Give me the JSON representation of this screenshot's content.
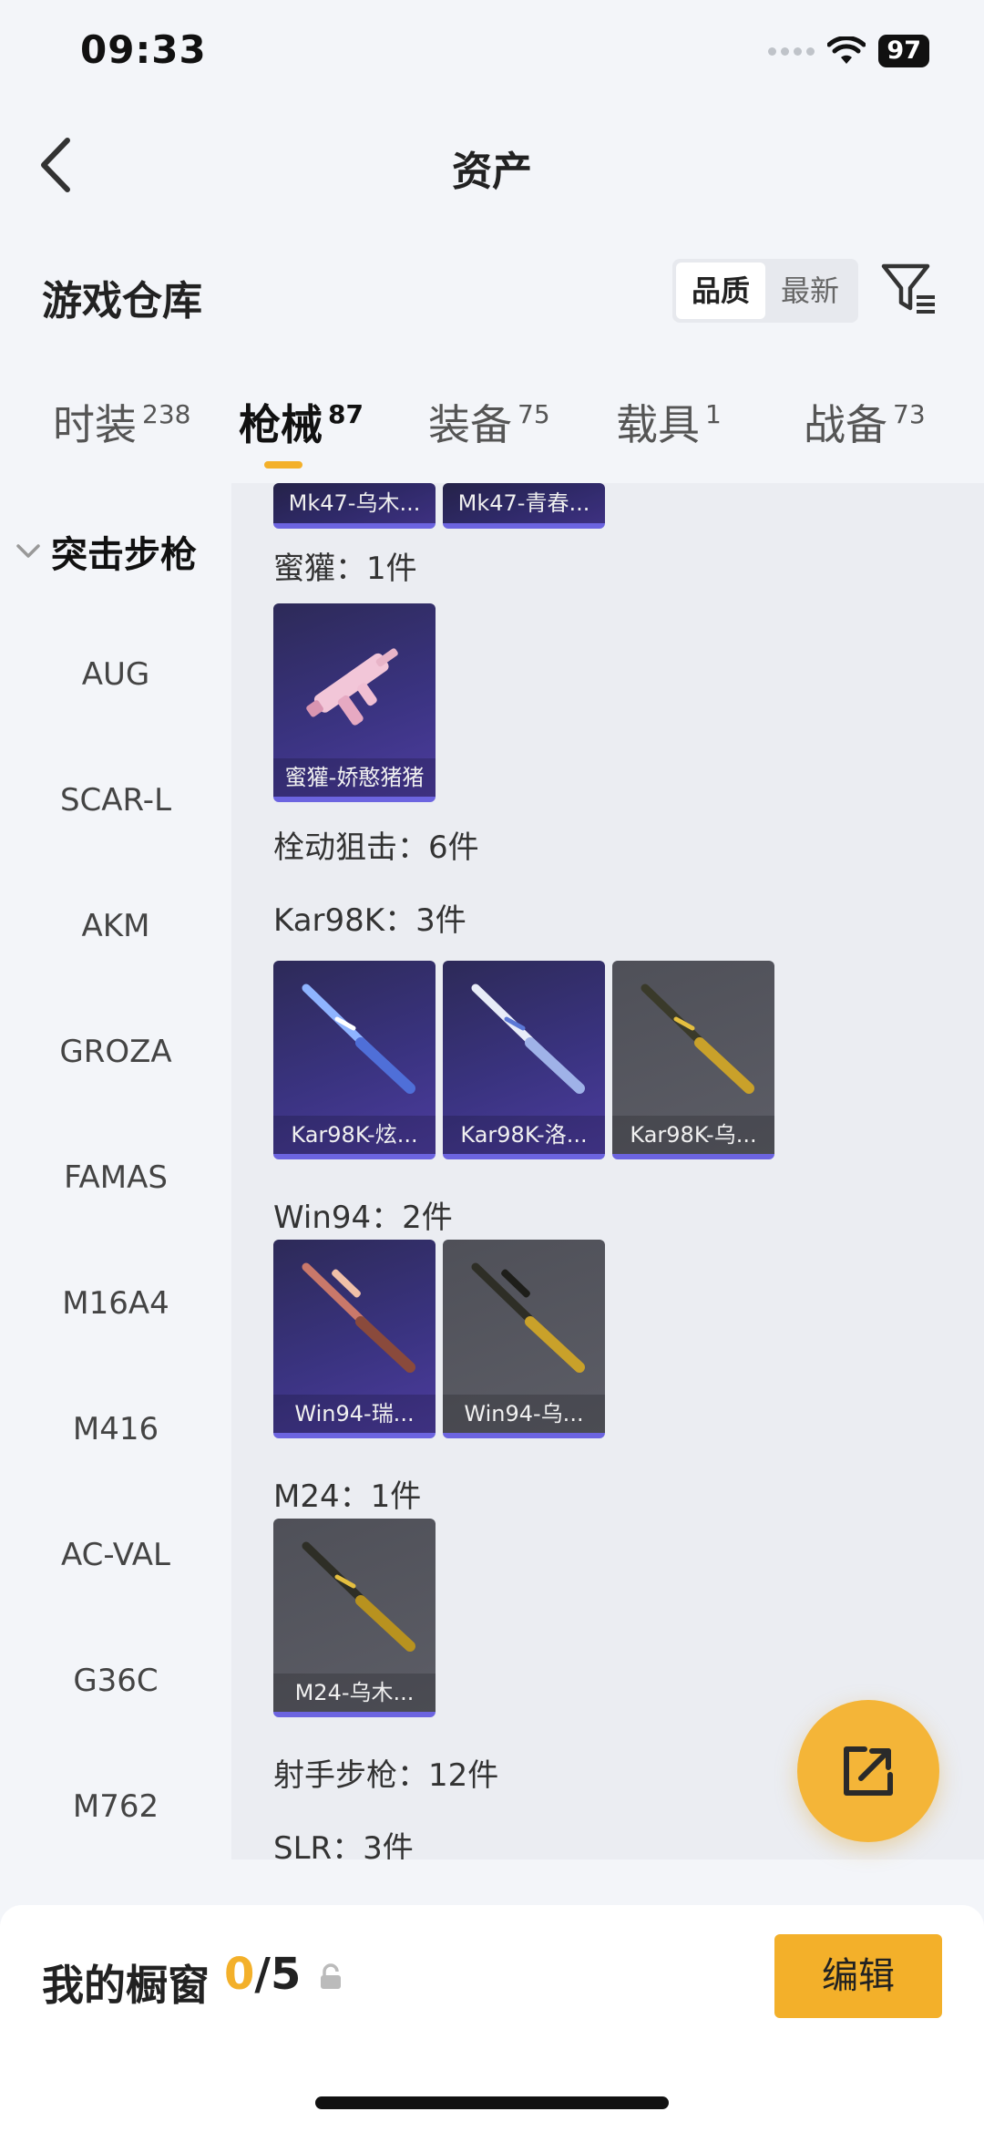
{
  "status_bar": {
    "time": "09:33",
    "battery": "97"
  },
  "nav": {
    "title": "资产"
  },
  "warehouse": {
    "title": "游戏仓库",
    "sort_options": [
      "品质",
      "最新"
    ],
    "active_sort": "品质"
  },
  "tabs": [
    {
      "label": "时装",
      "count": "238"
    },
    {
      "label": "枪械",
      "count": "87"
    },
    {
      "label": "装备",
      "count": "75"
    },
    {
      "label": "载具",
      "count": "1"
    },
    {
      "label": "战备",
      "count": "73"
    }
  ],
  "active_tab": "枪械",
  "sidebar": {
    "group": "突击步枪",
    "items": [
      "AUG",
      "SCAR-L",
      "AKM",
      "GROZA",
      "FAMAS",
      "M16A4",
      "M416",
      "AC-VAL",
      "G36C",
      "M762"
    ]
  },
  "content": {
    "top_cards": [
      "Mk47-乌木...",
      "Mk47-青春..."
    ],
    "groups": [
      {
        "label": "蜜獾：1件",
        "cards": [
          "蜜獾-娇憨猪猪"
        ]
      },
      {
        "label": "栓动狙击：6件"
      },
      {
        "label": "Kar98K：3件",
        "cards": [
          "Kar98K-炫...",
          "Kar98K-洛...",
          "Kar98K-乌..."
        ]
      },
      {
        "label": "Win94：2件",
        "cards": [
          "Win94-瑞...",
          "Win94-乌..."
        ]
      },
      {
        "label": "M24：1件",
        "cards": [
          "M24-乌木..."
        ]
      },
      {
        "label": "射手步枪：12件"
      },
      {
        "label": "SLR：3件"
      }
    ]
  },
  "showcase": {
    "title": "我的橱窗",
    "current": "0",
    "total": "/5",
    "edit_label": "编辑"
  },
  "colors": {
    "accent": "#f3b02a",
    "purple_card": "#3a3380",
    "gray_card": "#56575f"
  }
}
